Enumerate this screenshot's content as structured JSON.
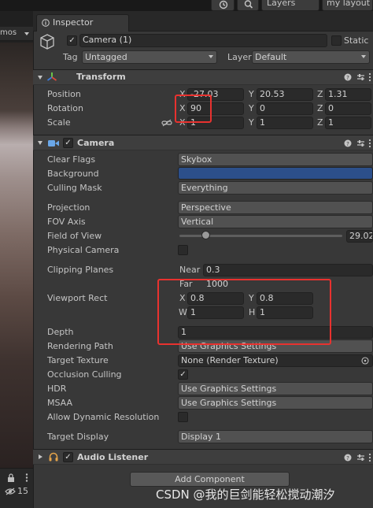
{
  "toolbar": {
    "history_icon": "history-icon",
    "search_icon": "search-icon",
    "layers_label": "Layers",
    "layout_label": "my layout"
  },
  "scene": {
    "gizmos_label": "mos",
    "hidden_count": "15"
  },
  "inspector": {
    "tab_label": "Inspector",
    "object_name": "Camera (1)",
    "static_label": "Static",
    "tag_label": "Tag",
    "tag_value": "Untagged",
    "layer_label": "Layer",
    "layer_value": "Default"
  },
  "transform": {
    "title": "Transform",
    "position_label": "Position",
    "rotation_label": "Rotation",
    "scale_label": "Scale",
    "x": "X",
    "y": "Y",
    "z": "Z",
    "position": {
      "x": "-27.03",
      "y": "20.53",
      "z": "1.31"
    },
    "rotation": {
      "x": "90",
      "y": "0",
      "z": "0"
    },
    "scale": {
      "x": "1",
      "y": "1",
      "z": "1"
    }
  },
  "camera": {
    "title": "Camera",
    "clear_flags_label": "Clear Flags",
    "clear_flags_value": "Skybox",
    "background_label": "Background",
    "background_color": "#2c4f8a",
    "culling_mask_label": "Culling Mask",
    "culling_mask_value": "Everything",
    "projection_label": "Projection",
    "projection_value": "Perspective",
    "fov_axis_label": "FOV Axis",
    "fov_axis_value": "Vertical",
    "fov_label": "Field of View",
    "fov_value": "29.02",
    "fov_fraction": 0.16,
    "physical_camera_label": "Physical Camera",
    "clipping_planes_label": "Clipping Planes",
    "near_label": "Near",
    "near_value": "0.3",
    "far_label": "Far",
    "far_value": "1000",
    "viewport_rect_label": "Viewport Rect",
    "vp_x_label": "X",
    "vp_x_value": "0.8",
    "vp_y_label": "Y",
    "vp_y_value": "0.8",
    "vp_w_label": "W",
    "vp_w_value": "1",
    "vp_h_label": "H",
    "vp_h_value": "1",
    "depth_label": "Depth",
    "depth_value": "1",
    "rendering_path_label": "Rendering Path",
    "rendering_path_value": "Use Graphics Settings",
    "target_texture_label": "Target Texture",
    "target_texture_value": "None (Render Texture)",
    "occlusion_culling_label": "Occlusion Culling",
    "hdr_label": "HDR",
    "hdr_value": "Use Graphics Settings",
    "msaa_label": "MSAA",
    "msaa_value": "Use Graphics Settings",
    "dynamic_res_label": "Allow Dynamic Resolution",
    "target_display_label": "Target Display",
    "target_display_value": "Display 1"
  },
  "audio_listener": {
    "title": "Audio Listener"
  },
  "add_component_label": "Add Component",
  "watermark": "CSDN @我的巨剑能轻松搅动潮汐",
  "colors": {
    "highlight": "#e8322f",
    "background": "#2c4f8a"
  }
}
